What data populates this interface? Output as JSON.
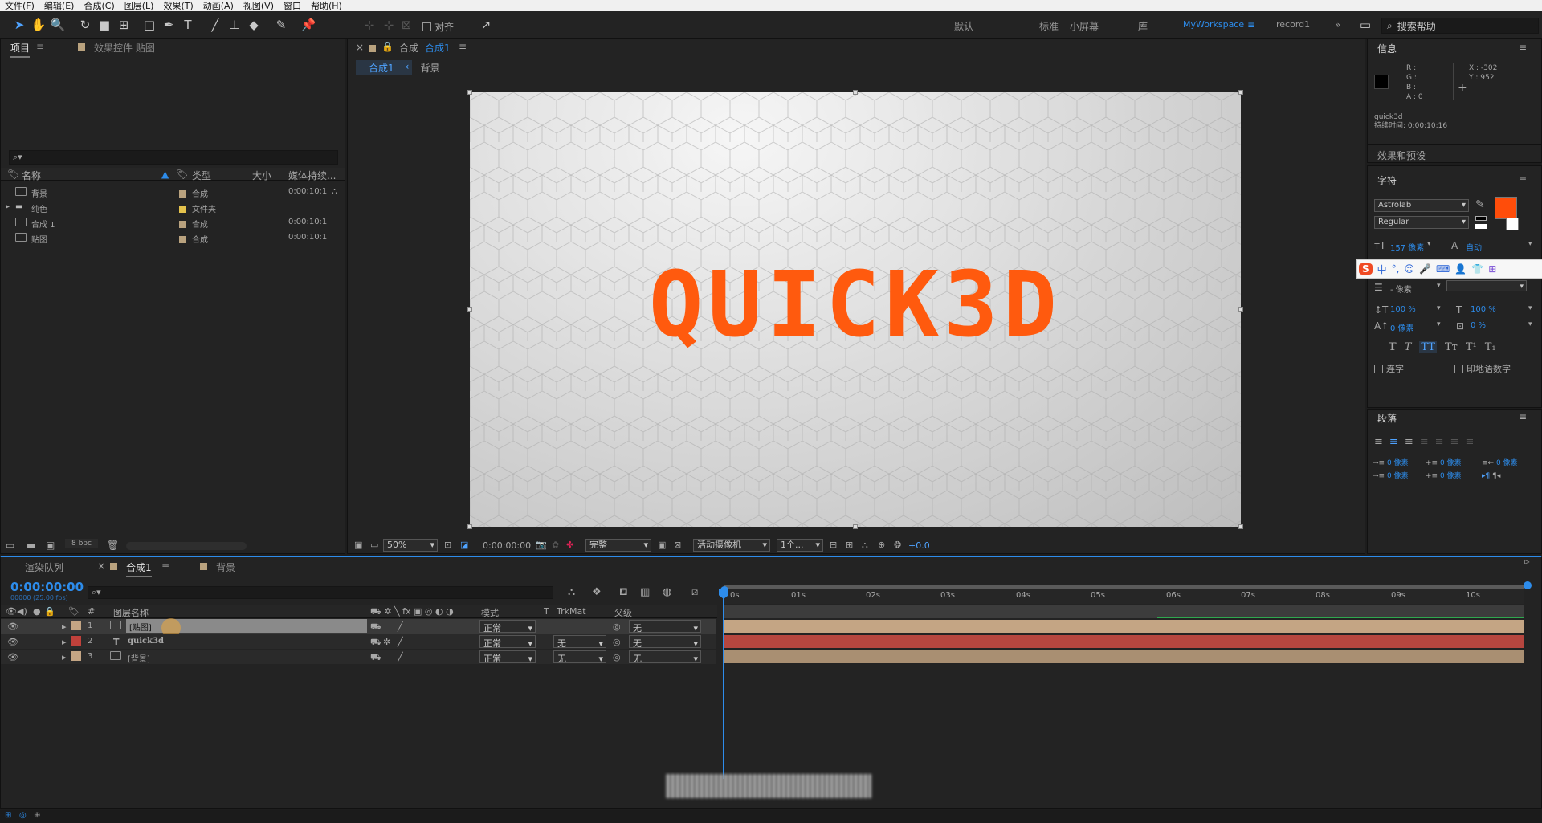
{
  "menu": [
    "文件(F)",
    "编辑(E)",
    "合成(C)",
    "图层(L)",
    "效果(T)",
    "动画(A)",
    "视图(V)",
    "窗口",
    "帮助(H)"
  ],
  "toolbar": {
    "align_label": "对齐",
    "workspaces": [
      "默认",
      "标准",
      "小屏幕",
      "库",
      "MyWorkspace",
      "record1"
    ],
    "active_workspace": "MyWorkspace",
    "search_help": "搜索帮助"
  },
  "project": {
    "tab_project": "项目",
    "tab_effects": "效果控件 贴图",
    "columns": {
      "name": "名称",
      "type": "类型",
      "size": "大小",
      "duration": "媒体持续..."
    },
    "items": [
      {
        "name": "背景",
        "type": "合成",
        "duration": "0:00:10:1",
        "color": "#b9a27e"
      },
      {
        "name": "纯色",
        "type": "文件夹",
        "duration": "",
        "color": "#e4c24c"
      },
      {
        "name": "合成 1",
        "type": "合成",
        "duration": "0:00:10:1",
        "color": "#b9a27e"
      },
      {
        "name": "贴图",
        "type": "合成",
        "duration": "0:00:10:1",
        "color": "#b9a27e"
      }
    ],
    "bpc": "8 bpc"
  },
  "viewer": {
    "tab_label": "合成",
    "tab_comp": "合成1",
    "breadcrumb": [
      "合成1",
      "背景"
    ],
    "title_text": "QUICK3D",
    "title_color": "#ff5a0e",
    "zoom": "50%",
    "timecode": "0:00:00:00",
    "quality": "完整",
    "camera": "活动摄像机",
    "views": "1个...",
    "exposure": "+0.0"
  },
  "info": {
    "title": "信息",
    "r": "R :",
    "g": "G :",
    "b": "B :",
    "a": "A : 0",
    "x": "X : -302",
    "y": "Y : 952",
    "layer_name": "quick3d",
    "duration": "持续时间: 0:00:10:16",
    "effects_presets": "效果和预设"
  },
  "character": {
    "title": "字符",
    "font": "Astrolab",
    "style": "Regular",
    "size": "157 像素",
    "leading": "自动",
    "stroke": "- 像素",
    "vscale": "100 %",
    "hscale": "100 %",
    "baseline": "0 像素",
    "tsume": "0 %",
    "ligature": "连字",
    "hindi": "印地语数字",
    "fill_color": "#ff4d0a"
  },
  "paragraph": {
    "title": "段落",
    "fields": [
      "0 像素",
      "0 像素",
      "0 像素",
      "0 像素",
      "0 像素"
    ]
  },
  "timeline": {
    "tab_render": "渲染队列",
    "tab_comp": "合成1",
    "tab_bg": "背景",
    "timecode": "0:00:00:00",
    "fps": "00000 (25.00 fps)",
    "columns": {
      "layer_name": "图层名称",
      "mode": "模式",
      "trkmat": "TrkMat",
      "parent": "父级"
    },
    "layers": [
      {
        "num": "1",
        "name": "[贴图]",
        "mode": "正常",
        "trkmat": "",
        "parent": "无",
        "color": "#c4a584",
        "bar_color": "#c4a584"
      },
      {
        "num": "2",
        "name": "quick3d",
        "mode": "正常",
        "trkmat": "无",
        "parent": "无",
        "color": "#c0413b",
        "bar_color": "#b6463f"
      },
      {
        "num": "3",
        "name": "[背景]",
        "mode": "正常",
        "trkmat": "无",
        "parent": "无",
        "color": "#c4a584",
        "bar_color": "#a98f72"
      }
    ],
    "ruler": [
      "0s",
      "01s",
      "02s",
      "03s",
      "04s",
      "05s",
      "06s",
      "07s",
      "08s",
      "09s",
      "10s"
    ]
  },
  "ime": {
    "label": "中"
  }
}
